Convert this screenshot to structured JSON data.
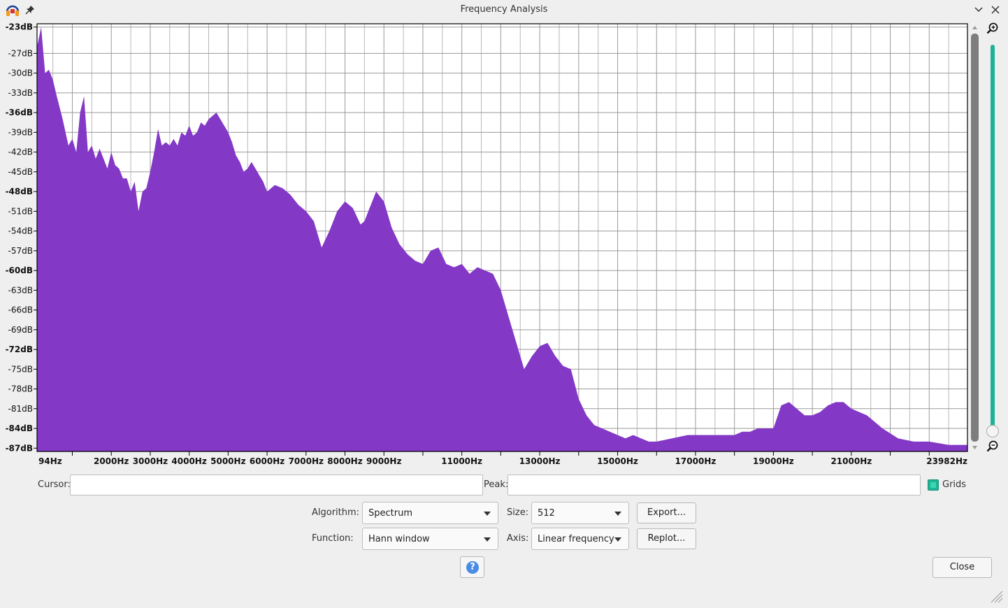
{
  "window": {
    "title": "Frequency Analysis"
  },
  "icons": {
    "app": "audacity-headphones-icon",
    "pin": "pin-icon",
    "minimize": "chevron-down-icon",
    "close": "close-icon",
    "zoom_in": "zoom-in-icon",
    "zoom_out": "zoom-out-icon",
    "help": "help-icon",
    "resize": "resize-grip-icon"
  },
  "colors": {
    "spectrum": "#8338c6",
    "zoom_accent": "#1db394",
    "help": "#4a8be6"
  },
  "chart_data": {
    "type": "area",
    "title": "",
    "xlabel": "",
    "ylabel": "",
    "y_ticks": [
      "-23dB",
      "-27dB",
      "-30dB",
      "-33dB",
      "-36dB",
      "-39dB",
      "-42dB",
      "-45dB",
      "-48dB",
      "-51dB",
      "-54dB",
      "-57dB",
      "-60dB",
      "-63dB",
      "-66dB",
      "-69dB",
      "-72dB",
      "-75dB",
      "-78dB",
      "-81dB",
      "-84dB",
      "-87dB"
    ],
    "y_tick_values": [
      -23,
      -27,
      -30,
      -33,
      -36,
      -39,
      -42,
      -45,
      -48,
      -51,
      -54,
      -57,
      -60,
      -63,
      -66,
      -69,
      -72,
      -75,
      -78,
      -81,
      -84,
      -87
    ],
    "y_bold_ticks": [
      "-23dB",
      "-36dB",
      "-48dB",
      "-60dB",
      "-72dB",
      "-84dB",
      "-87dB"
    ],
    "x_ticks": [
      "94Hz",
      "2000Hz",
      "3000Hz",
      "4000Hz",
      "5000Hz",
      "6000Hz",
      "7000Hz",
      "8000Hz",
      "9000Hz",
      "11000Hz",
      "13000Hz",
      "15000Hz",
      "17000Hz",
      "19000Hz",
      "21000Hz",
      "23982Hz"
    ],
    "x_tick_values": [
      94,
      2000,
      3000,
      4000,
      5000,
      6000,
      7000,
      8000,
      9000,
      11000,
      13000,
      15000,
      17000,
      19000,
      21000,
      23982
    ],
    "xlim": [
      94,
      23982
    ],
    "ylim": [
      -87.5,
      -22.5
    ],
    "grid": true,
    "x": [
      94,
      200,
      300,
      400,
      500,
      600,
      750,
      900,
      1000,
      1100,
      1200,
      1300,
      1400,
      1500,
      1600,
      1700,
      1800,
      1900,
      2000,
      2100,
      2200,
      2300,
      2400,
      2500,
      2600,
      2700,
      2800,
      2900,
      3000,
      3100,
      3200,
      3300,
      3400,
      3500,
      3600,
      3700,
      3800,
      3900,
      4000,
      4100,
      4200,
      4300,
      4400,
      4500,
      4600,
      4700,
      4800,
      4900,
      5000,
      5100,
      5200,
      5300,
      5400,
      5500,
      5600,
      5700,
      5800,
      5900,
      6000,
      6200,
      6400,
      6600,
      6800,
      7000,
      7200,
      7400,
      7600,
      7800,
      8000,
      8200,
      8400,
      8500,
      8600,
      8800,
      9000,
      9200,
      9400,
      9600,
      9800,
      10000,
      10200,
      10400,
      10600,
      10800,
      11000,
      11200,
      11400,
      11600,
      11800,
      12000,
      12200,
      12400,
      12600,
      12800,
      13000,
      13200,
      13400,
      13600,
      13800,
      14000,
      14200,
      14400,
      14600,
      14800,
      15000,
      15200,
      15400,
      15600,
      15800,
      16000,
      16400,
      16800,
      17200,
      17600,
      18000,
      18200,
      18400,
      18600,
      18800,
      19000,
      19200,
      19400,
      19600,
      19800,
      20000,
      20200,
      20400,
      20600,
      20800,
      21000,
      21400,
      21800,
      22200,
      22600,
      23000,
      23500,
      23982
    ],
    "y": [
      -26,
      -23,
      -30,
      -29.5,
      -31,
      -33.5,
      -37,
      -41,
      -40,
      -42,
      -36,
      -33.5,
      -42,
      -41,
      -43,
      -41.5,
      -43,
      -44.5,
      -42,
      -44,
      -44.5,
      -46,
      -46,
      -48,
      -46.5,
      -51,
      -48,
      -47.5,
      -45,
      -42,
      -38.5,
      -41,
      -40.5,
      -41,
      -40,
      -41,
      -39,
      -39.5,
      -38,
      -39.5,
      -39,
      -37.5,
      -38,
      -37,
      -36.5,
      -36,
      -37,
      -38,
      -39,
      -40.5,
      -42.5,
      -43.5,
      -45,
      -44.5,
      -43.5,
      -44.5,
      -45.5,
      -46.5,
      -48,
      -47,
      -47.5,
      -48.5,
      -50,
      -51,
      -52.5,
      -56.5,
      -54,
      -51,
      -49.5,
      -50.5,
      -53,
      -52.5,
      -51,
      -48,
      -49.5,
      -53.5,
      -56,
      -57.5,
      -58.5,
      -59,
      -57,
      -56.5,
      -59,
      -59.5,
      -59,
      -60.5,
      -59.5,
      -60,
      -60.5,
      -63,
      -67,
      -71,
      -75,
      -73,
      -71.5,
      -71,
      -73,
      -74.5,
      -75,
      -79.5,
      -82,
      -83.5,
      -84,
      -84.5,
      -85,
      -85.5,
      -85,
      -85.5,
      -86,
      -86,
      -85.5,
      -85,
      -85,
      -85,
      -85,
      -84.5,
      -84.5,
      -84,
      -84,
      -84,
      -80.5,
      -80,
      -81,
      -82,
      -82,
      -81.5,
      -80.5,
      -80,
      -80,
      -81,
      -82,
      -84,
      -85.5,
      -86,
      -86,
      -86.5,
      -86.5,
      -87,
      -87.5
    ]
  },
  "controls": {
    "cursor_label": "Cursor:",
    "cursor_value": "",
    "peak_label": "Peak:",
    "peak_value": "",
    "grids_label": "Grids",
    "algorithm_label": "Algorithm:",
    "algorithm_value": "Spectrum",
    "size_label": "Size:",
    "size_value": "512",
    "function_label": "Function:",
    "function_value": "Hann window",
    "axis_label": "Axis:",
    "axis_value": "Linear frequency",
    "export_button": "Export...",
    "replot_button": "Replot...",
    "help_glyph": "?",
    "close_button": "Close"
  }
}
